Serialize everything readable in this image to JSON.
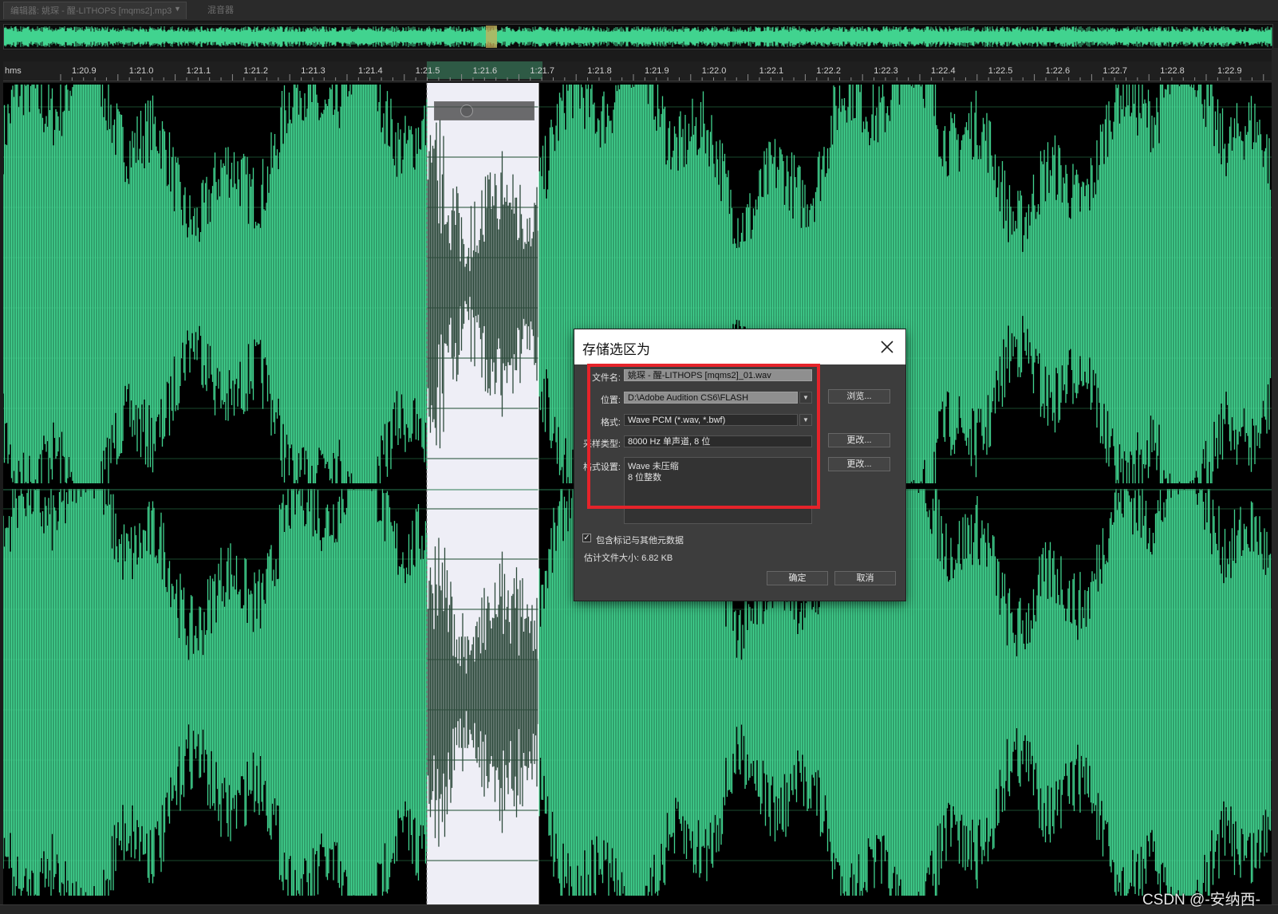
{
  "tabs": {
    "editor": "编辑器: 姚琛 - 醒-LITHOPS [mqms2].mp3",
    "dropdown_icon": "chevron-down-icon",
    "mixer": "混音器"
  },
  "ruler": {
    "unit": "hms",
    "labels": [
      "1:20.9",
      "1:21.0",
      "1:21.1",
      "1:21.2",
      "1:21.3",
      "1:21.4",
      "1:21.5",
      "1:21.6",
      "1:21.7",
      "1:21.8",
      "1:21.9",
      "1:22.0",
      "1:22.1",
      "1:22.2",
      "1:22.3",
      "1:22.4",
      "1:22.5",
      "1:22.6",
      "1:22.7",
      "1:22.8",
      "1:22.9"
    ]
  },
  "colors": {
    "waveform": "#41d38f",
    "waveform_selected": "#2e4a3c",
    "selection_bg": "#eeeef6",
    "highlight_box": "#e5232a"
  },
  "dialog": {
    "title": "存储选区为",
    "close_icon": "close-icon",
    "filename_label": "文件名:",
    "filename_value": "姚琛 - 醒-LITHOPS [mqms2]_01.wav",
    "location_label": "位置:",
    "location_value": "D:\\Adobe Audition CS6\\FLASH",
    "browse_button": "浏览...",
    "format_label": "格式:",
    "format_value": "Wave PCM (*.wav, *.bwf)",
    "sample_type_label": "采样类型:",
    "sample_type_value": "8000 Hz 单声道, 8 位",
    "change_button_1": "更改...",
    "format_settings_label": "格式设置:",
    "format_settings_line1": "Wave 未压缩",
    "format_settings_line2": "8 位整数",
    "change_button_2": "更改...",
    "include_markers_label": "包含标记与其他元数据",
    "include_markers_checked": true,
    "estimated_size": "估计文件大小: 6.82 KB",
    "ok_button": "确定",
    "cancel_button": "取消"
  },
  "watermark": "CSDN @-安纳西-"
}
